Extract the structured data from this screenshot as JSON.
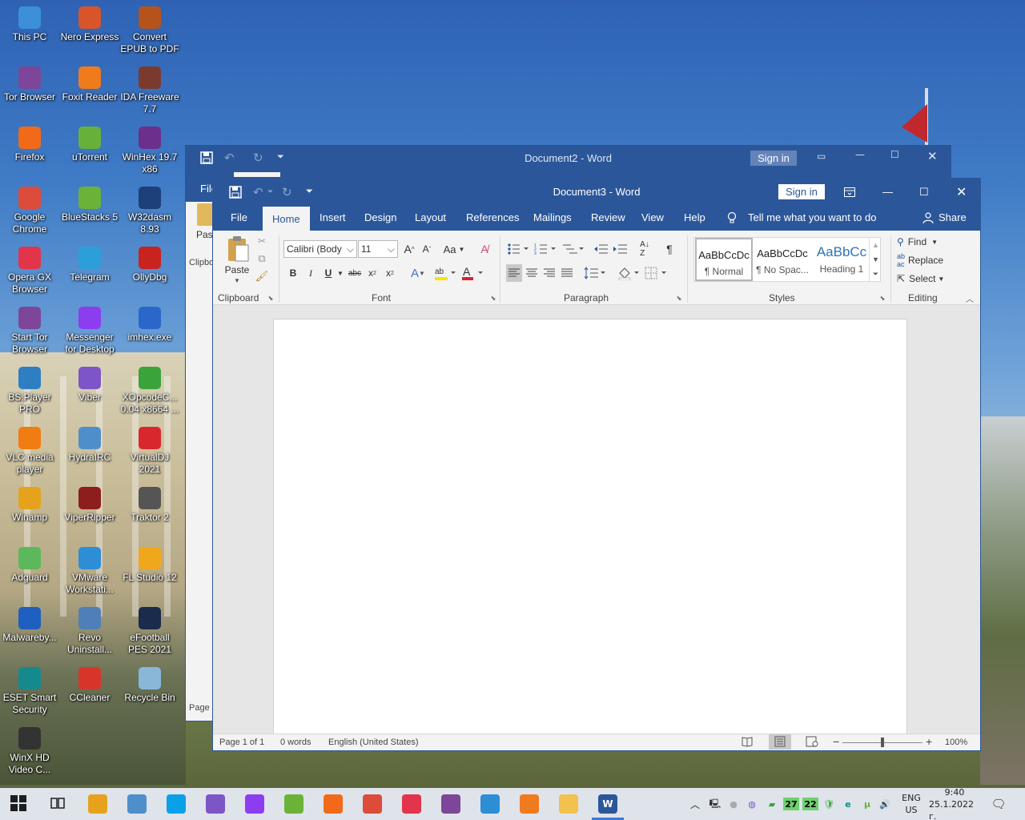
{
  "desktop": {
    "icons": [
      {
        "label": "This PC",
        "icon": "computer-icon",
        "color": "#3c8fd8"
      },
      {
        "label": "Nero Express",
        "icon": "nero-icon",
        "color": "#d8542a"
      },
      {
        "label": "Convert EPUB to PDF",
        "icon": "convert-icon",
        "color": "#b5531c"
      },
      {
        "label": "Tor Browser",
        "icon": "tor-icon",
        "color": "#7d4698"
      },
      {
        "label": "Foxit Reader",
        "icon": "foxit-icon",
        "color": "#f07b1d"
      },
      {
        "label": "IDA Freeware 7.7",
        "icon": "ida-icon",
        "color": "#7a3b2e"
      },
      {
        "label": "Firefox",
        "icon": "firefox-icon",
        "color": "#f06a1a"
      },
      {
        "label": "uTorrent",
        "icon": "utorrent-icon",
        "color": "#67b13a"
      },
      {
        "label": "WinHex 19.7 x86",
        "icon": "winhex-icon",
        "color": "#6d2f8c"
      },
      {
        "label": "Google Chrome",
        "icon": "chrome-icon",
        "color": "#dd4b3a"
      },
      {
        "label": "BlueStacks 5",
        "icon": "bluestacks-icon",
        "color": "#6bb238"
      },
      {
        "label": "W32dasm 8.93",
        "icon": "w32dasm-icon",
        "color": "#1d3f7a"
      },
      {
        "label": "Opera GX Browser",
        "icon": "opera-icon",
        "color": "#e2344b"
      },
      {
        "label": "Telegram",
        "icon": "telegram-icon",
        "color": "#2c9fd9"
      },
      {
        "label": "OllyDbg",
        "icon": "ollydbg-icon",
        "color": "#c8231f"
      },
      {
        "label": "Start Tor Browser",
        "icon": "tor-start-icon",
        "color": "#7d4698"
      },
      {
        "label": "Messenger for Desktop",
        "icon": "messenger-icon",
        "color": "#8d3df0"
      },
      {
        "label": "imhex.exe",
        "icon": "imhex-icon",
        "color": "#2a67c9"
      },
      {
        "label": "BS.Player PRO",
        "icon": "bsplayer-icon",
        "color": "#2d7fc2"
      },
      {
        "label": "Viber",
        "icon": "viber-icon",
        "color": "#7d55c7"
      },
      {
        "label": "XOpcodeC... 0.04 x8664 ...",
        "icon": "xopcode-icon",
        "color": "#3aa33a"
      },
      {
        "label": "VLC media player",
        "icon": "vlc-icon",
        "color": "#f07c12"
      },
      {
        "label": "HydraIRC",
        "icon": "hydrairc-icon",
        "color": "#4e8fcb"
      },
      {
        "label": "VirtualDJ 2021",
        "icon": "virtualdj-icon",
        "color": "#d9272e"
      },
      {
        "label": "Winamp",
        "icon": "winamp-icon",
        "color": "#e6a21c"
      },
      {
        "label": "ViperRipper",
        "icon": "viperripper-icon",
        "color": "#8e1d1d"
      },
      {
        "label": "Traktor 2",
        "icon": "traktor-icon",
        "color": "#555555"
      },
      {
        "label": "Adguard",
        "icon": "adguard-icon",
        "color": "#5cb85c"
      },
      {
        "label": "VMware Workstati...",
        "icon": "vmware-icon",
        "color": "#2d8ed6"
      },
      {
        "label": "FL Studio 12",
        "icon": "flstudio-icon",
        "color": "#f1a71b"
      },
      {
        "label": "Malwareby...",
        "icon": "malwarebytes-icon",
        "color": "#1f5fbf"
      },
      {
        "label": "Revo Uninstall...",
        "icon": "revo-icon",
        "color": "#4f7fb8"
      },
      {
        "label": "eFootball PES 2021",
        "icon": "efootball-icon",
        "color": "#1b2b4b"
      },
      {
        "label": "ESET Smart Security",
        "icon": "eset-icon",
        "color": "#158a8e"
      },
      {
        "label": "CCleaner",
        "icon": "ccleaner-icon",
        "color": "#d8352a"
      },
      {
        "label": "Recycle Bin",
        "icon": "recycle-bin-icon",
        "color": "#88b7d8"
      },
      {
        "label": "WinX HD Video C...",
        "icon": "winx-icon",
        "color": "#333333"
      }
    ]
  },
  "back_window": {
    "title": "Document2 - Word",
    "sign_in": "Sign in",
    "file_tab": "File",
    "paste_label": "Past",
    "clipboard_label": "Clipbo",
    "page_status": "Page"
  },
  "word": {
    "title": "Document3 - Word",
    "sign_in": "Sign in",
    "tabs": [
      "File",
      "Home",
      "Insert",
      "Design",
      "Layout",
      "References",
      "Mailings",
      "Review",
      "View",
      "Help"
    ],
    "active_tab": "Home",
    "tell_me": "Tell me what you want to do",
    "share": "Share",
    "clipboard": {
      "paste": "Paste",
      "label": "Clipboard"
    },
    "font": {
      "name": "Calibri (Body",
      "size": "11",
      "label": "Font",
      "change_case": "Aa"
    },
    "paragraph": {
      "label": "Paragraph"
    },
    "styles": {
      "label": "Styles",
      "items": [
        {
          "preview": "AaBbCcDc",
          "name": "¶ Normal"
        },
        {
          "preview": "AaBbCcDc",
          "name": "¶ No Spac..."
        },
        {
          "preview": "AaBbCc",
          "name": "Heading 1"
        }
      ]
    },
    "editing": {
      "find": "Find",
      "replace": "Replace",
      "select": "Select",
      "label": "Editing"
    },
    "status": {
      "page": "Page 1 of 1",
      "words": "0 words",
      "language": "English (United States)",
      "zoom": "100%"
    },
    "zoom_level": 1.0,
    "accent_color": "#2b579a"
  },
  "taskbar": {
    "apps": [
      {
        "name": "start-button",
        "color": "#1e1e1e"
      },
      {
        "name": "task-view",
        "color": "#1e1e1e"
      },
      {
        "name": "winamp",
        "color": "#e6a21c"
      },
      {
        "name": "hydrairc",
        "color": "#4e8fcb"
      },
      {
        "name": "skype",
        "color": "#0aa0e8"
      },
      {
        "name": "viber",
        "color": "#7d55c7"
      },
      {
        "name": "messenger",
        "color": "#8d3df0"
      },
      {
        "name": "bluestacks",
        "color": "#6bb238"
      },
      {
        "name": "firefox",
        "color": "#f06a1a"
      },
      {
        "name": "chrome",
        "color": "#dd4b3a"
      },
      {
        "name": "opera",
        "color": "#e2344b"
      },
      {
        "name": "tor",
        "color": "#7d4698"
      },
      {
        "name": "vmware",
        "color": "#2d8ed6"
      },
      {
        "name": "foxit",
        "color": "#f07b1d"
      },
      {
        "name": "explorer",
        "color": "#f2c14e"
      },
      {
        "name": "word",
        "color": "#2b579a"
      }
    ],
    "tray_numbers": [
      "27",
      "22"
    ],
    "language": "ENG",
    "layout": "US",
    "time": "9:40",
    "date": "25.1.2022 г."
  }
}
